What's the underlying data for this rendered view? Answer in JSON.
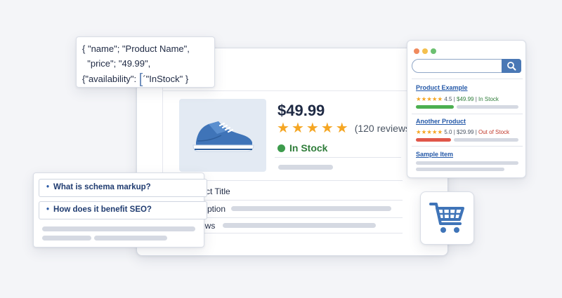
{
  "colors": {
    "accent": "#4a78b5",
    "star": "#f5a623",
    "in_stock": "#2f7d3a",
    "out_of_stock": "#c0392b",
    "link": "#2559a8"
  },
  "json_snippet": {
    "line1": "{ \"name\"; \"Product Name\",",
    "line2": "  \"price\"; \"49.99\",",
    "line3_key": "{\"availability\":",
    "line3_value": "´\"InStock\"",
    "line3_end": "}"
  },
  "product": {
    "image_icon": "sneaker-icon",
    "price": "$49.99",
    "rating": 5,
    "reviews": "(120 reviews)",
    "stock": "In Stock",
    "rows": [
      "Product Title",
      "Description",
      "Reviews"
    ]
  },
  "faq": {
    "items": [
      "What is schema markup?",
      "How does it benefit SEO?"
    ]
  },
  "serp": {
    "search_icon": "search-icon",
    "results": [
      {
        "title": "Product Example",
        "rating": "4.5",
        "price": "$49.99",
        "status": "In Stock",
        "status_type": "ok"
      },
      {
        "title": "Another Product",
        "rating": "5.0",
        "price": "$29.99",
        "status": "Out of Stock",
        "status_type": "bad"
      },
      {
        "title": "Sample Item"
      }
    ]
  },
  "cart_icon": "shopping-cart-icon"
}
